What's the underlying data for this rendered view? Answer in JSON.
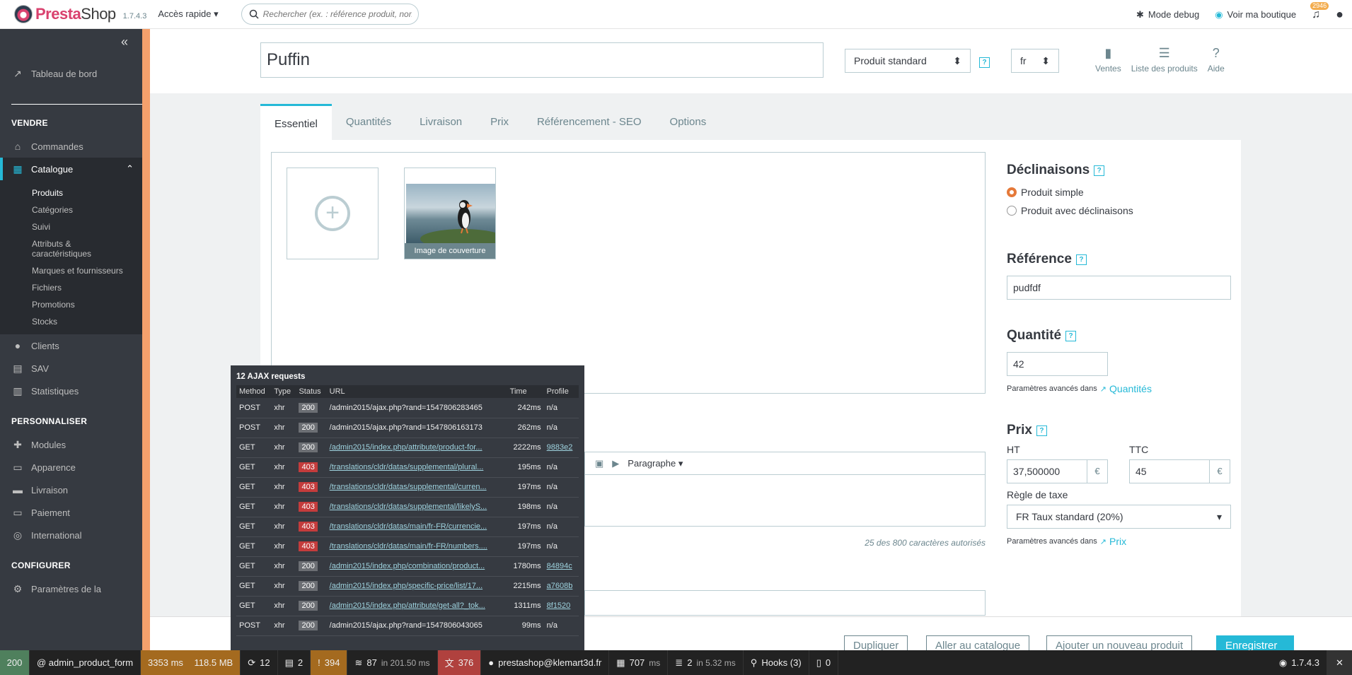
{
  "topbar": {
    "logo_main": "Presta",
    "logo_sub": "Shop",
    "version": "1.7.4.3",
    "quick_access": "Accès rapide",
    "search_placeholder": "Rechercher (ex. : référence produit, nom",
    "debug_mode": "Mode debug",
    "view_shop": "Voir ma boutique",
    "notifications_count": "2946"
  },
  "sidebar": {
    "dashboard": "Tableau de bord",
    "sections": {
      "sell": "VENDRE",
      "customize": "PERSONNALISER",
      "configure": "CONFIGURER"
    },
    "sell_items": [
      "Commandes",
      "Catalogue"
    ],
    "catalogue_sub": [
      "Produits",
      "Catégories",
      "Suivi",
      "Attributs & caractéristiques",
      "Marques et fournisseurs",
      "Fichiers",
      "Promotions",
      "Stocks"
    ],
    "sell_items_after": [
      "Clients",
      "SAV",
      "Statistiques"
    ],
    "customize_items": [
      "Modules",
      "Apparence",
      "Livraison",
      "Paiement",
      "International"
    ],
    "configure_items": [
      "Paramètres de la"
    ]
  },
  "product": {
    "name": "Puffin",
    "type": "Produit standard",
    "lang": "fr",
    "toolbar": [
      "Ventes",
      "Liste des produits",
      "Aide"
    ]
  },
  "tabs": [
    "Essentiel",
    "Quantités",
    "Livraison",
    "Prix",
    "Référencement - SEO",
    "Options"
  ],
  "images": {
    "cover_caption": "Image de couverture"
  },
  "editor": {
    "format_label": "Paragraphe",
    "char_count": "25 des 800 caractères autorisés"
  },
  "right": {
    "declinaisons_title": "Déclinaisons",
    "radio_simple": "Produit simple",
    "radio_variants": "Produit avec déclinaisons",
    "reference_title": "Référence",
    "reference_value": "pudfdf",
    "quantity_title": "Quantité",
    "quantity_value": "42",
    "advanced_params": "Paramètres avancés dans",
    "quantities_link": "Quantités",
    "price_title": "Prix",
    "ht_label": "HT",
    "ht_value": "37,500000",
    "ttc_label": "TTC",
    "ttc_value": "45",
    "currency": "€",
    "tax_rule_label": "Règle de taxe",
    "tax_rule_value": "FR Taux standard (20%)",
    "price_link": "Prix"
  },
  "footer_buttons": [
    "Dupliquer",
    "Aller au catalogue",
    "Ajouter un nouveau produit",
    "Enregistrer"
  ],
  "ajax": {
    "title": "12 AJAX requests",
    "headers": [
      "Method",
      "Type",
      "Status",
      "URL",
      "Time",
      "Profile"
    ],
    "rows": [
      {
        "method": "POST",
        "type": "xhr",
        "status": "200",
        "url": "/admin2015/ajax.php?rand=1547806283465",
        "time": "242ms",
        "profile": "n/a"
      },
      {
        "method": "POST",
        "type": "xhr",
        "status": "200",
        "url": "/admin2015/ajax.php?rand=1547806163173",
        "time": "262ms",
        "profile": "n/a"
      },
      {
        "method": "GET",
        "type": "xhr",
        "status": "200",
        "url": "/admin2015/index.php/attribute/product-for...",
        "time": "2222ms",
        "profile": "9883e2"
      },
      {
        "method": "GET",
        "type": "xhr",
        "status": "403",
        "url": "/translations/cldr/datas/supplemental/plural...",
        "time": "195ms",
        "profile": "n/a"
      },
      {
        "method": "GET",
        "type": "xhr",
        "status": "403",
        "url": "/translations/cldr/datas/supplemental/curren...",
        "time": "197ms",
        "profile": "n/a"
      },
      {
        "method": "GET",
        "type": "xhr",
        "status": "403",
        "url": "/translations/cldr/datas/supplemental/likelyS...",
        "time": "198ms",
        "profile": "n/a"
      },
      {
        "method": "GET",
        "type": "xhr",
        "status": "403",
        "url": "/translations/cldr/datas/main/fr-FR/currencie...",
        "time": "197ms",
        "profile": "n/a"
      },
      {
        "method": "GET",
        "type": "xhr",
        "status": "403",
        "url": "/translations/cldr/datas/main/fr-FR/numbers....",
        "time": "197ms",
        "profile": "n/a"
      },
      {
        "method": "GET",
        "type": "xhr",
        "status": "200",
        "url": "/admin2015/index.php/combination/product...",
        "time": "1780ms",
        "profile": "84894c"
      },
      {
        "method": "GET",
        "type": "xhr",
        "status": "200",
        "url": "/admin2015/index.php/specific-price/list/17...",
        "time": "2215ms",
        "profile": "a7608b"
      },
      {
        "method": "GET",
        "type": "xhr",
        "status": "200",
        "url": "/admin2015/index.php/attribute/get-all?_tok...",
        "time": "1311ms",
        "profile": "8f1520"
      },
      {
        "method": "POST",
        "type": "xhr",
        "status": "200",
        "url": "/admin2015/ajax.php?rand=1547806043065",
        "time": "99ms",
        "profile": "n/a"
      }
    ]
  },
  "debugbar": {
    "status": "200",
    "route": "@ admin_product_form",
    "time": "3353 ms",
    "memory": "118.5 MB",
    "ajax_count": "12",
    "forms": "2",
    "logs": "394",
    "cache": "87",
    "cache_in": "in 201.50 ms",
    "errors": "376",
    "user": "prestashop@klemart3d.fr",
    "twig": "707",
    "twig_unit": "ms",
    "db": "2",
    "db_in": "in 5.32 ms",
    "hooks": "Hooks (3)",
    "other": "0",
    "version": "1.7.4.3"
  },
  "colors": {
    "accent": "#25b9d7",
    "sidebar": "#363a41",
    "error_status": "#c43c3c",
    "strip": "#f4a06c"
  }
}
